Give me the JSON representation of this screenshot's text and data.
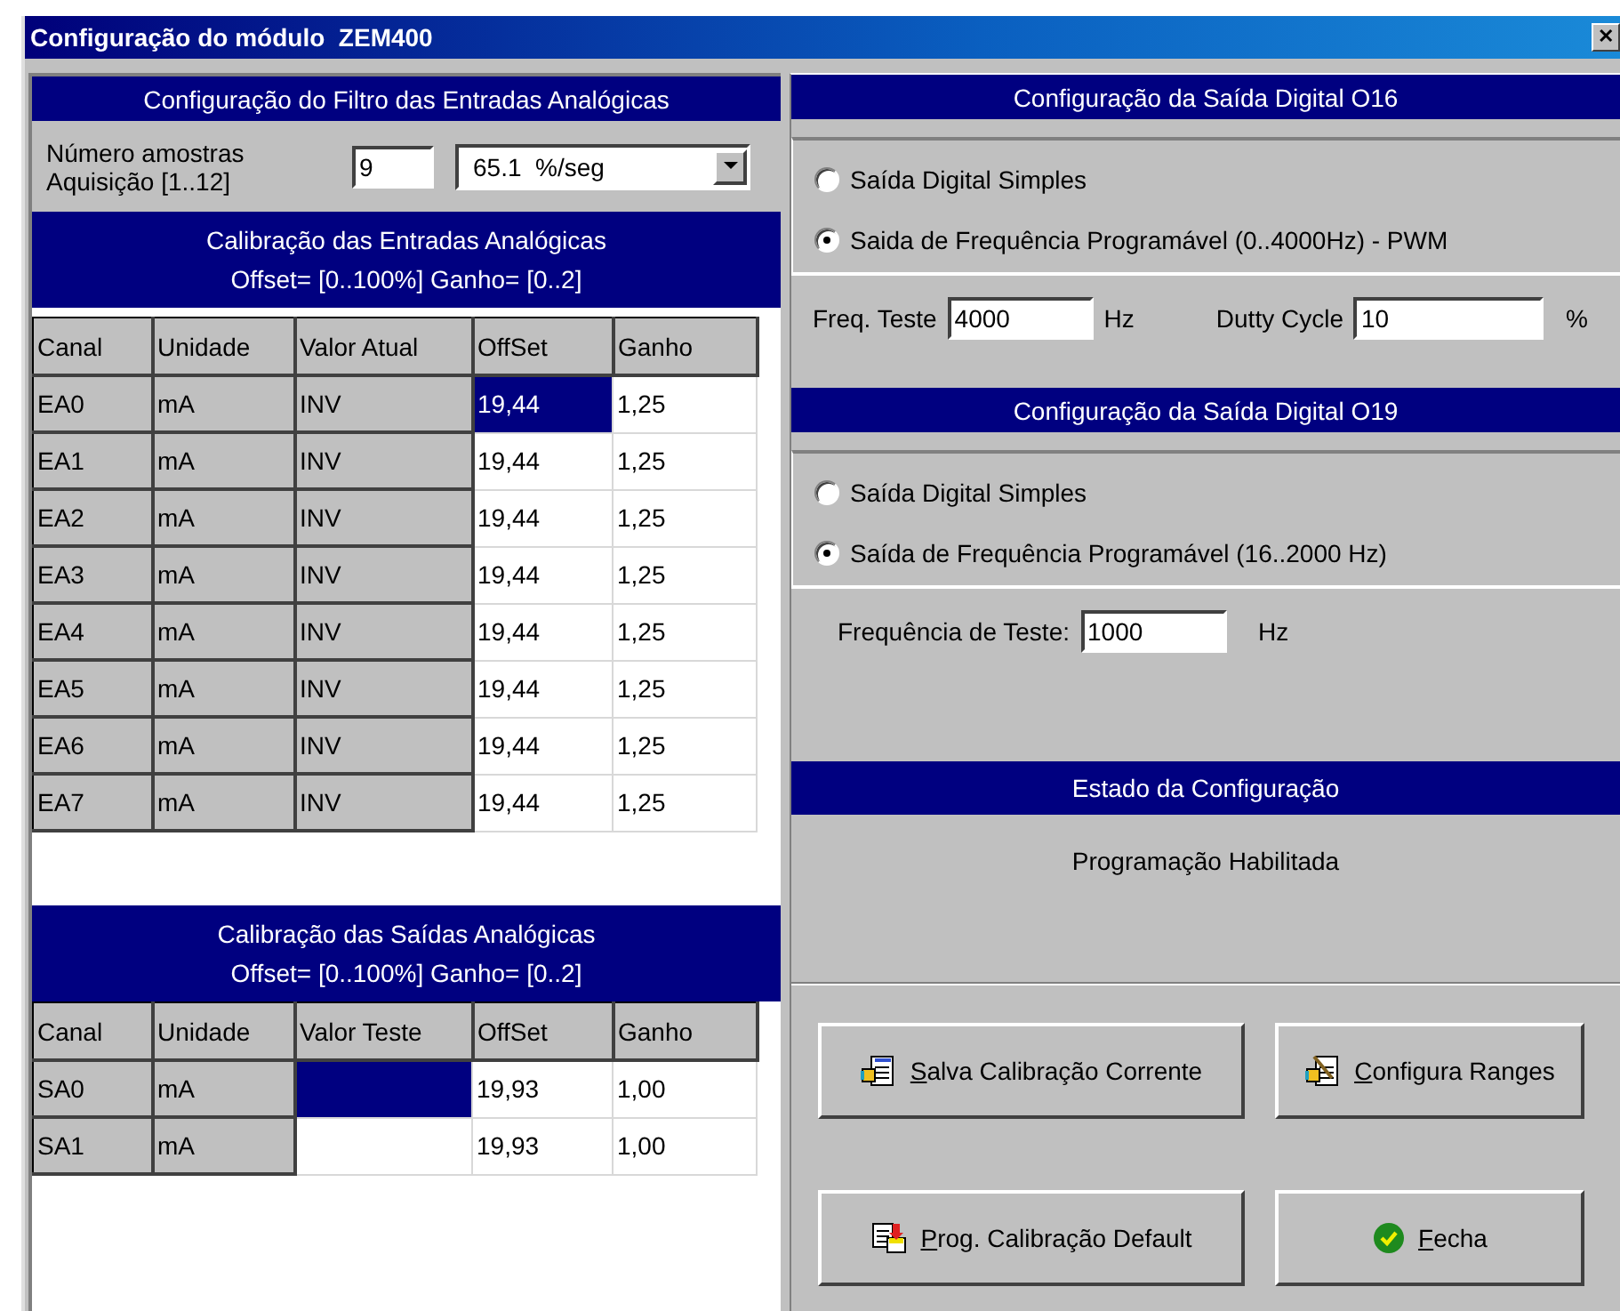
{
  "window": {
    "title": "Configuração do módulo  ZEM400",
    "close": "✕"
  },
  "filter": {
    "header": "Configuração do Filtro das Entradas Analógicas",
    "label": "Número amostras Aquisição [1..12]",
    "samples": "9",
    "rate": "65.1  %/seg"
  },
  "inputs": {
    "header": [
      "Calibração das Entradas Analógicas",
      "Offset= [0..100%]  Ganho= [0..2]"
    ],
    "columns": [
      "Canal",
      "Unidade",
      "Valor Atual",
      "OffSet",
      "Ganho"
    ],
    "rows": [
      {
        "cells": [
          {
            "text": "EA0",
            "editable": false,
            "selected": false
          },
          {
            "text": "mA",
            "editable": false,
            "selected": false
          },
          {
            "text": "INV",
            "editable": false,
            "selected": false
          },
          {
            "text": "19,44",
            "editable": true,
            "selected": true
          },
          {
            "text": "1,25",
            "editable": true,
            "selected": false
          }
        ]
      },
      {
        "cells": [
          {
            "text": "EA1",
            "editable": false,
            "selected": false
          },
          {
            "text": "mA",
            "editable": false,
            "selected": false
          },
          {
            "text": "INV",
            "editable": false,
            "selected": false
          },
          {
            "text": "19,44",
            "editable": true,
            "selected": false
          },
          {
            "text": "1,25",
            "editable": true,
            "selected": false
          }
        ]
      },
      {
        "cells": [
          {
            "text": "EA2",
            "editable": false,
            "selected": false
          },
          {
            "text": "mA",
            "editable": false,
            "selected": false
          },
          {
            "text": "INV",
            "editable": false,
            "selected": false
          },
          {
            "text": "19,44",
            "editable": true,
            "selected": false
          },
          {
            "text": "1,25",
            "editable": true,
            "selected": false
          }
        ]
      },
      {
        "cells": [
          {
            "text": "EA3",
            "editable": false,
            "selected": false
          },
          {
            "text": "mA",
            "editable": false,
            "selected": false
          },
          {
            "text": "INV",
            "editable": false,
            "selected": false
          },
          {
            "text": "19,44",
            "editable": true,
            "selected": false
          },
          {
            "text": "1,25",
            "editable": true,
            "selected": false
          }
        ]
      },
      {
        "cells": [
          {
            "text": "EA4",
            "editable": false,
            "selected": false
          },
          {
            "text": "mA",
            "editable": false,
            "selected": false
          },
          {
            "text": "INV",
            "editable": false,
            "selected": false
          },
          {
            "text": "19,44",
            "editable": true,
            "selected": false
          },
          {
            "text": "1,25",
            "editable": true,
            "selected": false
          }
        ]
      },
      {
        "cells": [
          {
            "text": "EA5",
            "editable": false,
            "selected": false
          },
          {
            "text": "mA",
            "editable": false,
            "selected": false
          },
          {
            "text": "INV",
            "editable": false,
            "selected": false
          },
          {
            "text": "19,44",
            "editable": true,
            "selected": false
          },
          {
            "text": "1,25",
            "editable": true,
            "selected": false
          }
        ]
      },
      {
        "cells": [
          {
            "text": "EA6",
            "editable": false,
            "selected": false
          },
          {
            "text": "mA",
            "editable": false,
            "selected": false
          },
          {
            "text": "INV",
            "editable": false,
            "selected": false
          },
          {
            "text": "19,44",
            "editable": true,
            "selected": false
          },
          {
            "text": "1,25",
            "editable": true,
            "selected": false
          }
        ]
      },
      {
        "cells": [
          {
            "text": "EA7",
            "editable": false,
            "selected": false
          },
          {
            "text": "mA",
            "editable": false,
            "selected": false
          },
          {
            "text": "INV",
            "editable": false,
            "selected": false
          },
          {
            "text": "19,44",
            "editable": true,
            "selected": false
          },
          {
            "text": "1,25",
            "editable": true,
            "selected": false
          }
        ]
      }
    ]
  },
  "outputs": {
    "header": [
      "Calibração das Saídas Analógicas",
      "Offset= [0..100%]  Ganho= [0..2]"
    ],
    "columns": [
      "Canal",
      "Unidade",
      "Valor Teste",
      "OffSet",
      "Ganho"
    ],
    "rows": [
      {
        "cells": [
          {
            "text": "SA0",
            "editable": false,
            "selected": false
          },
          {
            "text": "mA",
            "editable": false,
            "selected": false
          },
          {
            "text": "",
            "editable": true,
            "selected": true
          },
          {
            "text": "19,93",
            "editable": true,
            "selected": false
          },
          {
            "text": "1,00",
            "editable": true,
            "selected": false
          }
        ]
      },
      {
        "cells": [
          {
            "text": "SA1",
            "editable": false,
            "selected": false
          },
          {
            "text": "mA",
            "editable": false,
            "selected": false
          },
          {
            "text": "",
            "editable": true,
            "selected": false
          },
          {
            "text": "19,93",
            "editable": true,
            "selected": false
          },
          {
            "text": "1,00",
            "editable": true,
            "selected": false
          }
        ]
      }
    ]
  },
  "o16": {
    "header": "Configuração da Saída Digital O16",
    "options": [
      {
        "label": "Saída Digital Simples",
        "selected": false
      },
      {
        "label": "Saida de Frequência Programável (0..4000Hz) - PWM",
        "selected": true
      }
    ],
    "freq_label": "Freq. Teste",
    "freq": "4000",
    "freq_unit": "Hz",
    "duty_label": "Dutty Cycle",
    "duty": "10",
    "duty_unit": "%"
  },
  "o19": {
    "header": "Configuração da Saída Digital O19",
    "options": [
      {
        "label": "Saída Digital Simples",
        "selected": false
      },
      {
        "label": "Saída de Frequência Programável (16..2000 Hz)",
        "selected": true
      }
    ],
    "freq_label": "Frequência de Teste:",
    "freq": "1000",
    "freq_unit": "Hz"
  },
  "status": {
    "header": "Estado da Configuração",
    "text": "Programação Habilitada"
  },
  "buttons": [
    {
      "label": "Salva Calibração Corrente",
      "kind": "save"
    },
    {
      "label": "Configura Ranges",
      "kind": "edit"
    },
    {
      "label": "Prog. Calibração Default",
      "kind": "load"
    },
    {
      "label": "Fecha",
      "kind": "ok"
    }
  ]
}
